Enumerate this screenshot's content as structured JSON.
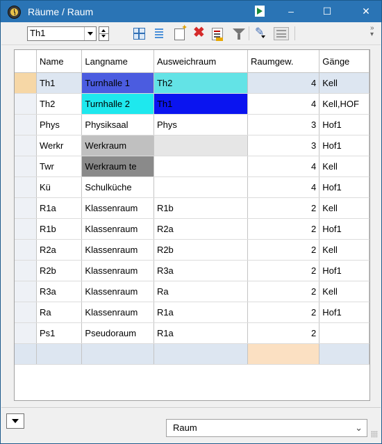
{
  "window": {
    "title": "Räume / Raum"
  },
  "toolbar": {
    "combo_value": "Th1",
    "overflow": "»"
  },
  "grid": {
    "columns": [
      "Name",
      "Langname",
      "Ausweichraum",
      "Raumgew.",
      "Gänge"
    ],
    "rows": [
      {
        "name": "Th1",
        "long": "Turnhalle 1",
        "alt": "Th2",
        "weight": "4",
        "gaenge": "Kell"
      },
      {
        "name": "Th2",
        "long": "Turnhalle 2",
        "alt": "Th1",
        "weight": "4",
        "gaenge": "Kell,HOF"
      },
      {
        "name": "Phys",
        "long": "Physiksaal",
        "alt": "Phys",
        "weight": "3",
        "gaenge": "Hof1"
      },
      {
        "name": "Werkr",
        "long": "Werkraum",
        "alt": "",
        "weight": "3",
        "gaenge": "Hof1"
      },
      {
        "name": "Twr",
        "long": "Werkraum te",
        "alt": "",
        "weight": "4",
        "gaenge": "Kell"
      },
      {
        "name": "Kü",
        "long": "Schulküche",
        "alt": "",
        "weight": "4",
        "gaenge": "Hof1"
      },
      {
        "name": "R1a",
        "long": "Klassenraum",
        "alt": "R1b",
        "weight": "2",
        "gaenge": "Kell"
      },
      {
        "name": "R1b",
        "long": "Klassenraum",
        "alt": "R2a",
        "weight": "2",
        "gaenge": "Hof1"
      },
      {
        "name": "R2a",
        "long": "Klassenraum",
        "alt": "R2b",
        "weight": "2",
        "gaenge": "Kell"
      },
      {
        "name": "R2b",
        "long": "Klassenraum",
        "alt": "R3a",
        "weight": "2",
        "gaenge": "Hof1"
      },
      {
        "name": "R3a",
        "long": "Klassenraum",
        "alt": "Ra",
        "weight": "2",
        "gaenge": "Kell"
      },
      {
        "name": "Ra",
        "long": "Klassenraum",
        "alt": "R1a",
        "weight": "2",
        "gaenge": "Hof1"
      },
      {
        "name": "Ps1",
        "long": "Pseudoraum",
        "alt": "R1a",
        "weight": "2",
        "gaenge": ""
      }
    ],
    "cell_colors": {
      "row0_long": "#4b5ce0",
      "row0_alt": "#63e3e6",
      "row1_long": "#1ee8ee",
      "row1_alt": "#0a14f0",
      "row3_long": "#c0c0c0",
      "row3_alt": "#e6e6e6",
      "row4_long": "#8a8a8a"
    }
  },
  "bottom": {
    "view_select": "Raum"
  },
  "colors": {
    "titlebar": "#2a74b5",
    "selection": "#dde6f1",
    "current_row_indicator": "#f6d7a6"
  }
}
